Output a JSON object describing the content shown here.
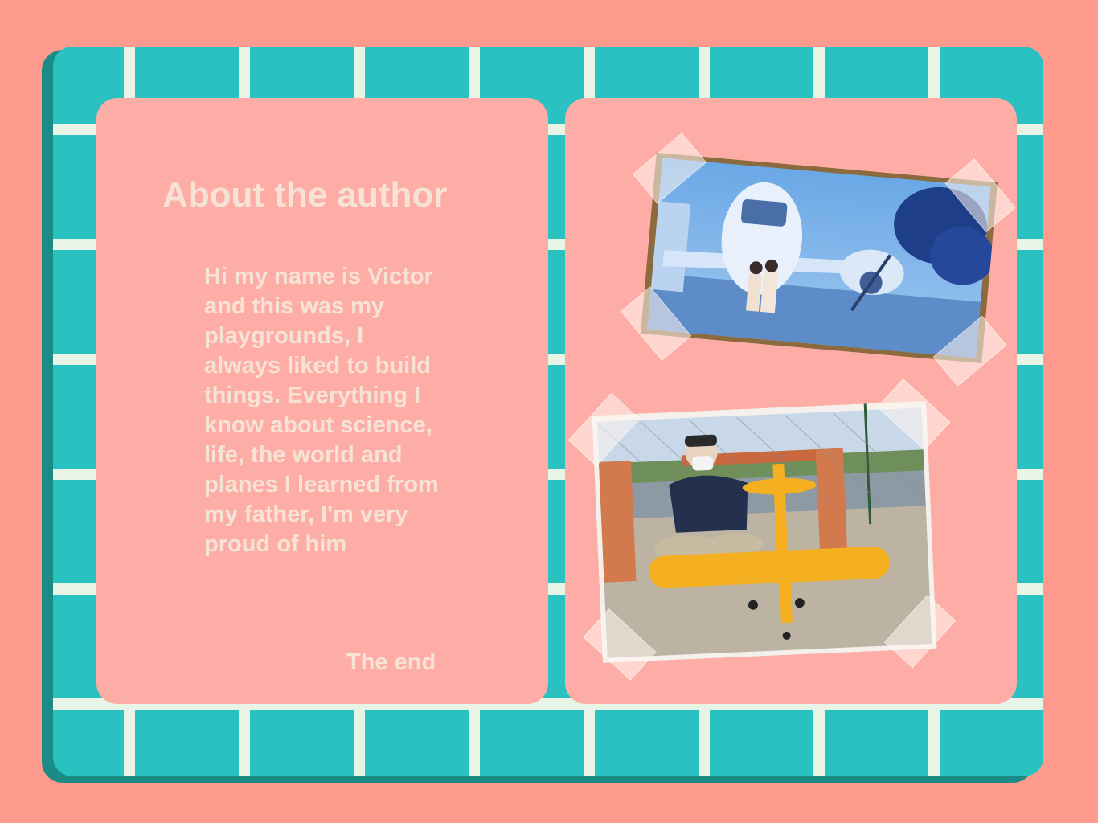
{
  "page_left": {
    "title": "About the author",
    "body": "Hi my name is Victor and this was my playgrounds, I always liked to build things. Everything I know about science, life, the world and planes I learned from my father, I'm very proud of him",
    "end": "The end"
  },
  "page_right": {
    "photos": [
      {
        "subject": "old-photo-children-in-front-of-airplane"
      },
      {
        "subject": "person-with-yellow-model-airplane"
      }
    ]
  },
  "colors": {
    "background": "#ff9b8e",
    "book_teal": "#2ac1c1",
    "grid_lines": "#e8f4e6",
    "page_pink": "#feada6",
    "text_cream": "#f7e3d6",
    "plane_yellow": "#f4b021"
  }
}
